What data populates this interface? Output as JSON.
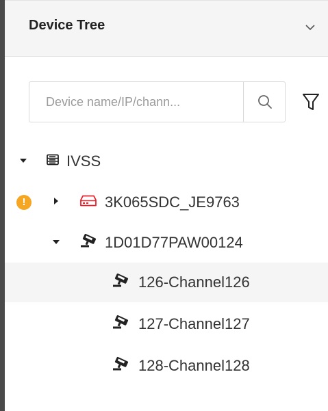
{
  "header": {
    "title": "Device Tree",
    "collapse_icon": "chevron-down-icon"
  },
  "search": {
    "placeholder": "Device name/IP/chann...",
    "value": "",
    "search_icon": "search-icon",
    "filter_icon": "filter-icon"
  },
  "colors": {
    "offline_device": "#e8202a",
    "warning": "#f5a623",
    "selected_row_bg": "#f5f5f5",
    "text": "#333333"
  },
  "tree": {
    "root": {
      "label": "IVSS",
      "icon": "server-icon",
      "expanded": true
    },
    "devices": [
      {
        "label": "3K065SDC_JE9763",
        "icon": "nvr-device-icon",
        "status": "offline",
        "warning": true,
        "expanded": false
      },
      {
        "label": "1D01D77PAW00124",
        "icon": "camera-icon",
        "expanded": true,
        "channels": [
          {
            "label": "126-Channel126",
            "icon": "camera-icon",
            "selected": true
          },
          {
            "label": "127-Channel127",
            "icon": "camera-icon",
            "selected": false
          },
          {
            "label": "128-Channel128",
            "icon": "camera-icon",
            "selected": false
          }
        ]
      }
    ]
  }
}
